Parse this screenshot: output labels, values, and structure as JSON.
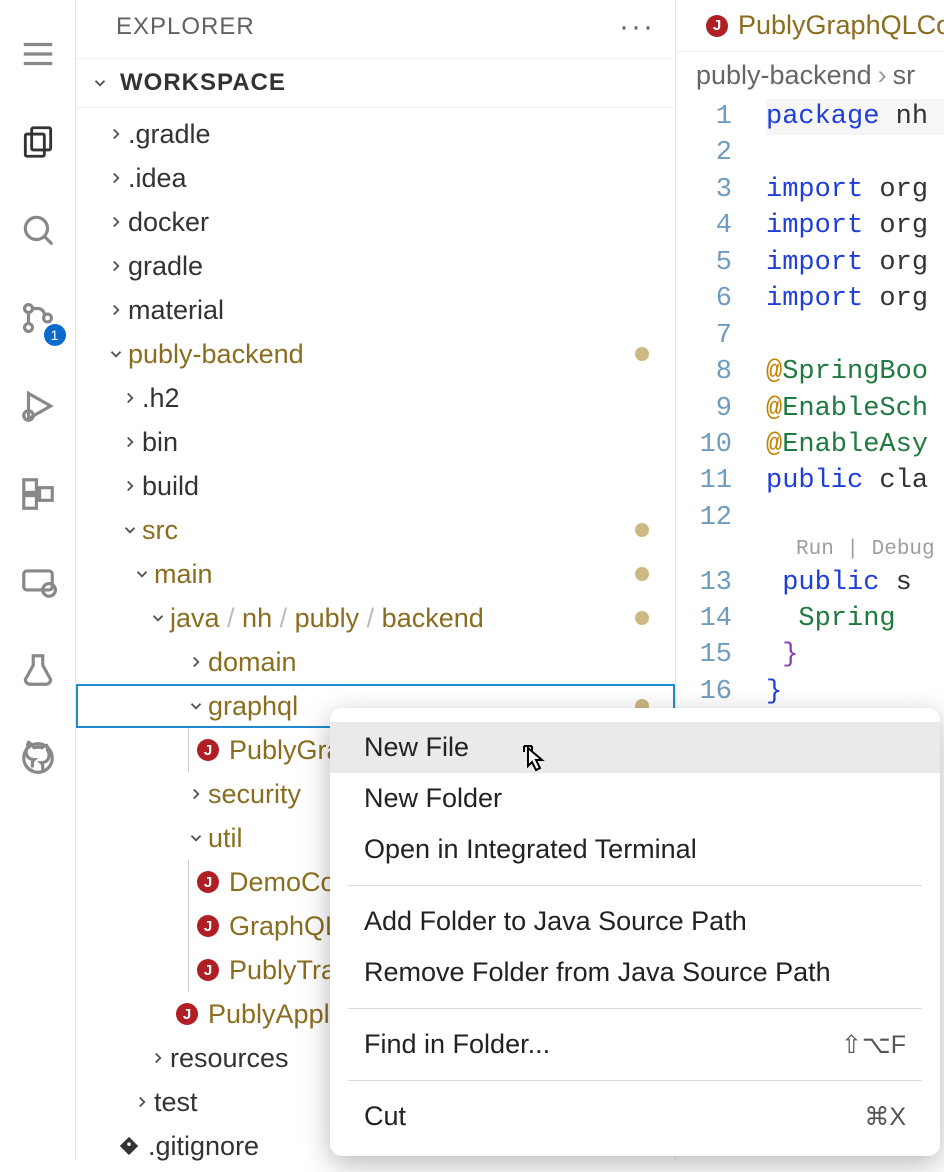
{
  "activity": {
    "badge": "1"
  },
  "sidebar": {
    "title": "EXPLORER",
    "section": "WORKSPACE"
  },
  "tree": {
    "gradle": ".gradle",
    "idea": ".idea",
    "docker": "docker",
    "gradleFolder": "gradle",
    "material": "material",
    "publyBackend": "publy-backend",
    "h2": ".h2",
    "bin": "bin",
    "build": "build",
    "src": "src",
    "main": "main",
    "javaPath": {
      "a": "java",
      "b": "nh",
      "c": "publy",
      "d": "backend"
    },
    "domain": "domain",
    "graphql": "graphql",
    "publyGra": "PublyGra",
    "security": "security",
    "util": "util",
    "demoCo": "DemoCo",
    "graphQL": "GraphQL",
    "publyTra": "PublyTra",
    "publyAppl": "PublyAppl",
    "resources": "resources",
    "test": "test",
    "gitignore": ".gitignore"
  },
  "tab": {
    "name": "PublyGraphQLCo"
  },
  "breadcrumb": {
    "a": "publy-backend",
    "b": "sr"
  },
  "code": {
    "l1": "package",
    "l1b": "nh",
    "l3": "import",
    "l3b": "org",
    "l4": "import",
    "l4b": "org",
    "l5": "import",
    "l5b": "org",
    "l6": "import",
    "l6b": "org",
    "l8a": "@",
    "l8b": "SpringBoo",
    "l9a": "@",
    "l9b": "EnableSch",
    "l10a": "@",
    "l10b": "EnableAsy",
    "l11a": "public",
    "l11b": "cla",
    "codelens": "Run | Debug",
    "l13a": "public",
    "l13b": " s",
    "l14": "Spring"
  },
  "lineNums": [
    "1",
    "2",
    "3",
    "4",
    "5",
    "6",
    "7",
    "8",
    "9",
    "10",
    "11",
    "12",
    "13",
    "14",
    "15",
    "16"
  ],
  "ctx": {
    "newFile": "New File",
    "newFolder": "New Folder",
    "openTerm": "Open in Integrated Terminal",
    "addJava": "Add Folder to Java Source Path",
    "removeJava": "Remove Folder from Java Source Path",
    "find": "Find in Folder...",
    "findShort": "⇧⌥F",
    "cut": "Cut",
    "cutShort": "⌘X"
  }
}
